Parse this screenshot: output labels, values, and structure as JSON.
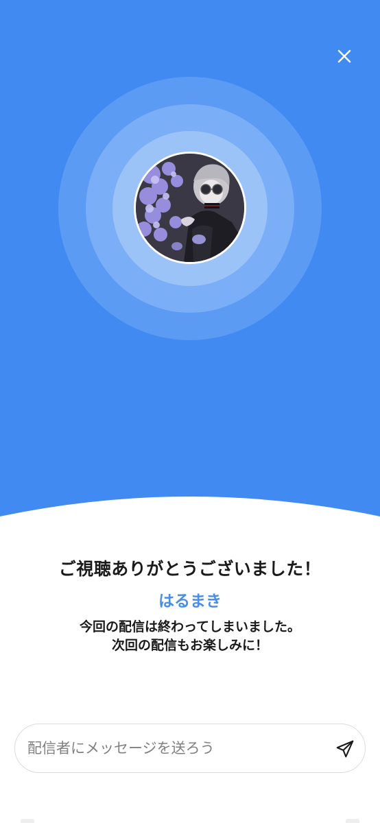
{
  "theme": {
    "accent": "#418af2",
    "name_color": "#4a8de6"
  },
  "header": {
    "close_icon": "close-icon"
  },
  "avatar": {
    "description_icon": "streamer-avatar"
  },
  "end_screen": {
    "title": "ご視聴ありがとうございました！",
    "streamer_name": "はるまき",
    "message_line1": "今回の配信は終わってしまいました。",
    "message_line2": "次回の配信もお楽しみに！"
  },
  "message_box": {
    "placeholder": "配信者にメッセージを送ろう",
    "value": "",
    "send_icon": "send-icon"
  }
}
